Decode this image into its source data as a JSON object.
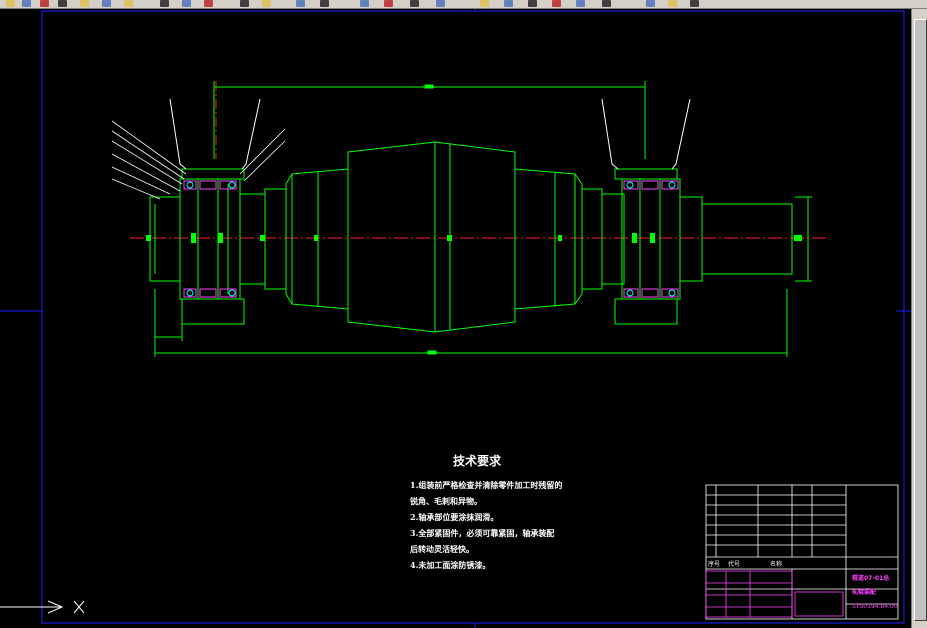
{
  "tech_requirements": {
    "title": "技术要求",
    "lines": [
      "1.组装前严格检查并清除零件加工时残留的",
      "锐角、毛刺和异物。",
      "2.轴承部位要涂抹润滑。",
      "3.全部紧固件，必须可靠紧固，轴承装配",
      "后转动灵活轻快。",
      "4.未加工面涂防锈漆。"
    ]
  },
  "title_block": {
    "drawing_no": "辊道07-01总",
    "drawing_name": "轧辊装配",
    "doc_code": "SYS0194.84.00",
    "col_seq": "序号",
    "col_code": "代号",
    "col_name": "名称"
  },
  "colors": {
    "background": "#000000",
    "outline": "#00ff00",
    "centerline": "#ff0000",
    "frame": "#0000ff",
    "dimension": "#00ffff",
    "detail": "#ff00ff",
    "text": "#ffffff"
  }
}
